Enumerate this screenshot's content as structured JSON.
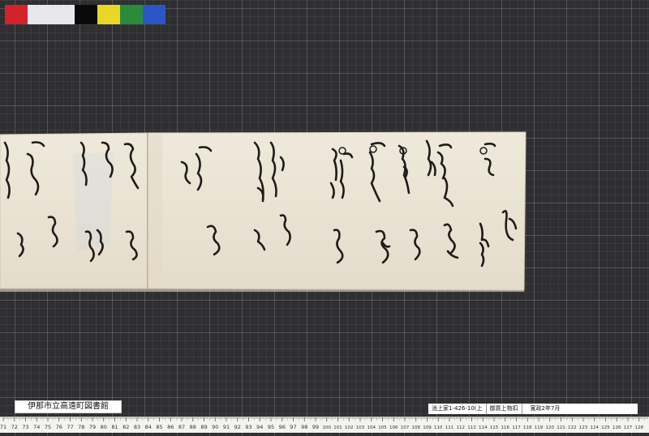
{
  "color_chart": [
    "#d3222a",
    "#e8e8ec",
    "#0a0a0a",
    "#e9d728",
    "#2a8b3a",
    "#2c55c8"
  ],
  "library_label": "伊那市立高遠町図書館",
  "catalog": {
    "call_number": "池上家1-426-10(上",
    "title": "御買上物扣",
    "date": "寛政2年7月"
  },
  "ruler": {
    "labels": [
      "71",
      "72",
      "73",
      "74",
      "75",
      "76",
      "77",
      "78",
      "79",
      "80",
      "81",
      "82",
      "83",
      "84",
      "85",
      "86",
      "87",
      "88",
      "89",
      "90",
      "91",
      "92",
      "93",
      "94",
      "95",
      "96",
      "97",
      "98",
      "99",
      "100",
      "101",
      "102",
      "103",
      "104",
      "105",
      "106",
      "107",
      "108",
      "109",
      "110",
      "111",
      "112",
      "113",
      "114",
      "115",
      "116",
      "117",
      "118",
      "119",
      "120",
      "121",
      "122",
      "123",
      "124",
      "125",
      "126",
      "127",
      "128"
    ]
  }
}
